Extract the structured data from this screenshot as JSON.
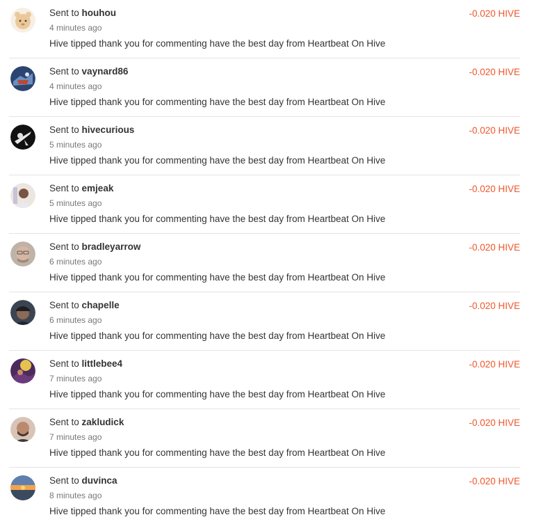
{
  "transactions": [
    {
      "prefix": "Sent to",
      "user": "houhou",
      "time": "4 minutes ago",
      "memo": "Hive tipped thank you for commenting have the best day from Heartbeat On Hive",
      "amount": "-0.020 HIVE",
      "avatar_icon": "houhou-avatar",
      "avatar_colors": [
        "#f3e6d3",
        "#d9b78c"
      ]
    },
    {
      "prefix": "Sent to",
      "user": "vaynard86",
      "time": "4 minutes ago",
      "memo": "Hive tipped thank you for commenting have the best day from Heartbeat On Hive",
      "amount": "-0.020 HIVE",
      "avatar_icon": "vaynard86-avatar",
      "avatar_colors": [
        "#2b3f6b",
        "#b84a3a"
      ]
    },
    {
      "prefix": "Sent to",
      "user": "hivecurious",
      "time": "5 minutes ago",
      "memo": "Hive tipped thank you for commenting have the best day from Heartbeat On Hive",
      "amount": "-0.020 HIVE",
      "avatar_icon": "hivecurious-avatar",
      "avatar_colors": [
        "#111111",
        "#eeeeee"
      ]
    },
    {
      "prefix": "Sent to",
      "user": "emjeak",
      "time": "5 minutes ago",
      "memo": "Hive tipped thank you for commenting have the best day from Heartbeat On Hive",
      "amount": "-0.020 HIVE",
      "avatar_icon": "emjeak-avatar",
      "avatar_colors": [
        "#e8e2dc",
        "#6b4a3a"
      ]
    },
    {
      "prefix": "Sent to",
      "user": "bradleyarrow",
      "time": "6 minutes ago",
      "memo": "Hive tipped thank you for commenting have the best day from Heartbeat On Hive",
      "amount": "-0.020 HIVE",
      "avatar_icon": "bradleyarrow-avatar",
      "avatar_colors": [
        "#b9a89a",
        "#8a6e5e"
      ]
    },
    {
      "prefix": "Sent to",
      "user": "chapelle",
      "time": "6 minutes ago",
      "memo": "Hive tipped thank you for commenting have the best day from Heartbeat On Hive",
      "amount": "-0.020 HIVE",
      "avatar_icon": "chapelle-avatar",
      "avatar_colors": [
        "#3a4350",
        "#8a6a56"
      ]
    },
    {
      "prefix": "Sent to",
      "user": "littlebee4",
      "time": "7 minutes ago",
      "memo": "Hive tipped thank you for commenting have the best day from Heartbeat On Hive",
      "amount": "-0.020 HIVE",
      "avatar_icon": "littlebee4-avatar",
      "avatar_colors": [
        "#4a2a5a",
        "#e0b84a"
      ]
    },
    {
      "prefix": "Sent to",
      "user": "zakludick",
      "time": "7 minutes ago",
      "memo": "Hive tipped thank you for commenting have the best day from Heartbeat On Hive",
      "amount": "-0.020 HIVE",
      "avatar_icon": "zakludick-avatar",
      "avatar_colors": [
        "#d9c2b4",
        "#6a4a3a"
      ]
    },
    {
      "prefix": "Sent to",
      "user": "duvinca",
      "time": "8 minutes ago",
      "memo": "Hive tipped thank you for commenting have the best day from Heartbeat On Hive",
      "amount": "-0.020 HIVE",
      "avatar_icon": "duvinca-avatar",
      "avatar_colors": [
        "#f2a64a",
        "#5a7aa8"
      ]
    }
  ],
  "colors": {
    "amount": "#f0552a",
    "divider": "#e3e3e3",
    "text": "#333333",
    "muted": "#777777"
  }
}
